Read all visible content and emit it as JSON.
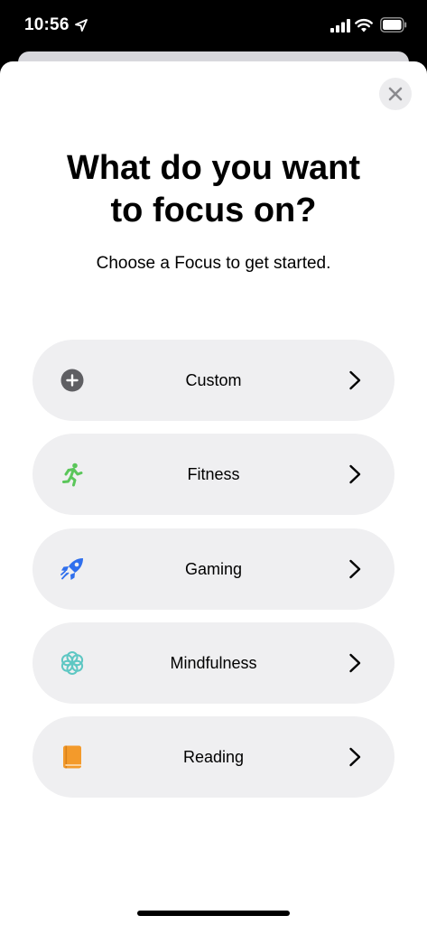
{
  "status_bar": {
    "time": "10:56",
    "location_icon": "location-arrow-icon",
    "signal_icon": "cellular-signal-icon",
    "wifi_icon": "wifi-icon",
    "battery_icon": "battery-icon"
  },
  "sheet": {
    "close_icon": "close-icon",
    "title": "What do you want\nto focus on?",
    "subtitle": "Choose a Focus to get started."
  },
  "options": [
    {
      "label": "Custom",
      "icon": "plus-circle-icon",
      "color": "#5f5f63"
    },
    {
      "label": "Fitness",
      "icon": "running-person-icon",
      "color": "#5ac65a"
    },
    {
      "label": "Gaming",
      "icon": "rocket-icon",
      "color": "#2f6fed"
    },
    {
      "label": "Mindfulness",
      "icon": "flower-icon",
      "color": "#5ec7c3"
    },
    {
      "label": "Reading",
      "icon": "book-icon",
      "color": "#f39a2b"
    }
  ],
  "colors": {
    "option_background": "#efeff1",
    "sheet_background": "#ffffff"
  }
}
